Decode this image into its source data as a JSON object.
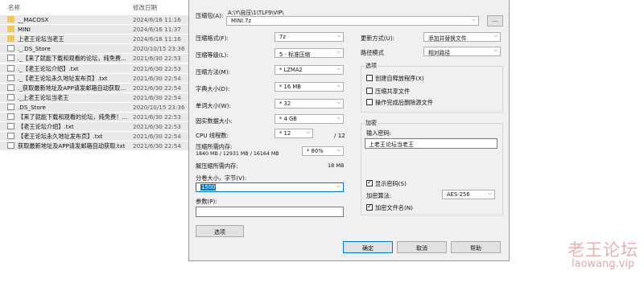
{
  "explorer": {
    "col_name": "名称",
    "col_date": "修改日期",
    "files": [
      {
        "name": "__MACOSX",
        "date": "2024/6/16 11:16",
        "type": "folder"
      },
      {
        "name": "MINI",
        "date": "2024/6/16 11:37",
        "type": "folder"
      },
      {
        "name": "上老王论坛当老王",
        "date": "2024/6/16 11:16",
        "type": "folder"
      },
      {
        "name": "._.DS_Store",
        "date": "2020/10/15 23:36",
        "type": "file"
      },
      {
        "name": "._【来了就能下载和观看的论坛，纯免费...",
        "date": "2021/6/30 22:53",
        "type": "file"
      },
      {
        "name": "._【老王论坛介绍】.txt",
        "date": "2021/6/30 22:53",
        "type": "file"
      },
      {
        "name": "._【老王论坛永久地址发布页】.txt",
        "date": "2021/6/30 22:54",
        "type": "file"
      },
      {
        "name": "._获取最新地址及APP请发邮箱自动获取...",
        "date": "2021/6/30 22:54",
        "type": "file"
      },
      {
        "name": "._上老王论坛当老王",
        "date": "2021/6/30 22:54",
        "type": "file"
      },
      {
        "name": ".DS_Store",
        "date": "2020/10/15 23:36",
        "type": "file"
      },
      {
        "name": "【来了就能下载和观看的论坛，纯免费！...",
        "date": "2021/6/30 22:53",
        "type": "file"
      },
      {
        "name": "【老王论坛介绍】.txt",
        "date": "2021/6/30 22:53",
        "type": "file"
      },
      {
        "name": "【老王论坛永久地址发布页】.txt",
        "date": "2021/6/30 22:54",
        "type": "file"
      },
      {
        "name": "获取最新地址及APP请发邮箱自动获取.txt",
        "date": "2021/6/30 22:54",
        "type": "file"
      }
    ]
  },
  "dialog": {
    "archive_label": "压缩包(A):",
    "archive_path": "A:\\Y\\自压\\1\\TLF9\\VIP\\",
    "archive_name": "MINI.7z",
    "browse_label": "...",
    "format_label": "压缩格式(F):",
    "format_value": "7z",
    "level_label": "压缩等级(L):",
    "level_value": "5 - 标准压缩",
    "method_label": "压缩方法(M):",
    "method_value": "* LZMA2",
    "dict_label": "字典大小(D):",
    "dict_value": "* 16 MB",
    "word_label": "单词大小(W):",
    "word_value": "* 32",
    "solid_label": "固实数据大小:",
    "solid_value": "* 4 GB",
    "cpu_label": "CPU 线程数:",
    "cpu_value": "* 12",
    "cpu_total": "/ 12",
    "mem_label": "压缩所需内存:",
    "mem_detail": "1840 MB / 12931 MB / 16164 MB",
    "mem_value": "* 80%",
    "decomp_label": "解压缩所需内存:",
    "decomp_value": "18 MB",
    "split_label": "分卷大小，字节(V):",
    "split_value": "1500",
    "params_label": "参数(P):",
    "params_value": "",
    "options_button": "选项",
    "update_label": "更新方式(U):",
    "update_value": "添加并替换文件",
    "path_label": "路径模式",
    "path_value": "相对路径",
    "options_group": "选项",
    "opt_sfx": "创建自释放程序(X)",
    "opt_shared": "压缩共享文件",
    "opt_delete": "操作完成后删除源文件",
    "encrypt_group": "加密",
    "password_label": "输入密码:",
    "password_value": "上老王论坛当老王",
    "show_password": "显示密码(S)",
    "enc_method_label": "加密算法:",
    "enc_method_value": "AES-256",
    "encrypt_names": "加密文件名(N)",
    "ok": "确定",
    "cancel": "取消",
    "help": "帮助"
  },
  "watermark": {
    "cn": "老王论坛",
    "url": "laowang.vip"
  }
}
